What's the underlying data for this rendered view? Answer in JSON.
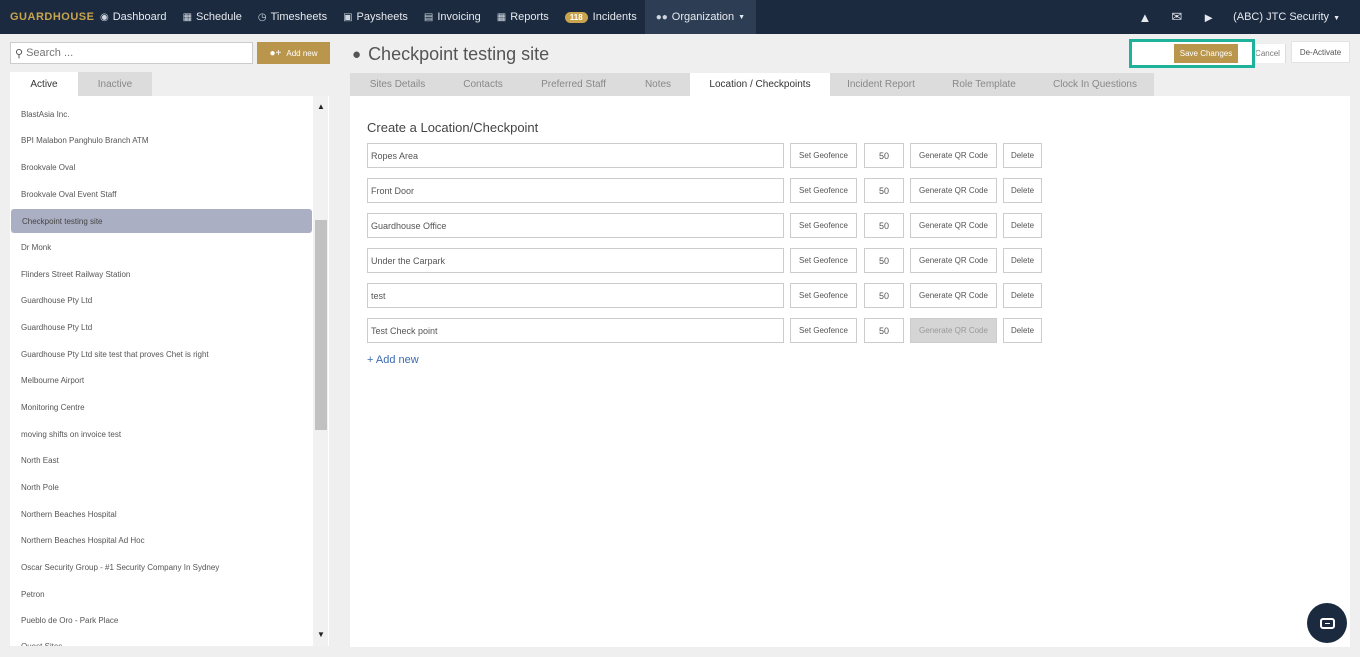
{
  "nav": {
    "brand": "GUARDHOUSE",
    "items": [
      {
        "label": "Dashboard",
        "icon": "dashboard-icon"
      },
      {
        "label": "Schedule",
        "icon": "calendar-icon"
      },
      {
        "label": "Timesheets",
        "icon": "clock-icon"
      },
      {
        "label": "Paysheets",
        "icon": "money-icon"
      },
      {
        "label": "Invoicing",
        "icon": "invoice-icon"
      },
      {
        "label": "Reports",
        "icon": "table-icon"
      },
      {
        "label": "Incidents",
        "badge": "118"
      },
      {
        "label": "Organization",
        "icon": "users-icon"
      }
    ],
    "account": "(ABC) JTC Security"
  },
  "sidebar": {
    "search_placeholder": "Search ...",
    "add_new": "Add new",
    "tabs": {
      "active": "Active",
      "inactive": "Inactive"
    },
    "sites": [
      "BlastAsia Inc.",
      "BPI Malabon Panghulo Branch ATM",
      "Brookvale Oval",
      "Brookvale Oval Event Staff",
      "Checkpoint testing site",
      "Dr Monk",
      "Flinders Street Railway Station",
      "Guardhouse Pty Ltd",
      "Guardhouse Pty Ltd",
      "Guardhouse Pty Ltd site test that proves Chet is right",
      "Melbourne Airport",
      "Monitoring Centre",
      "moving shifts on invoice test",
      "North East",
      "North Pole",
      "Northern Beaches Hospital",
      "Northern Beaches Hospital Ad Hoc",
      "Oscar Security Group - #1 Security Company In Sydney",
      "Petron",
      "Pueblo de Oro - Park Place",
      "Quest Sites"
    ],
    "selected": "Checkpoint testing site"
  },
  "header": {
    "title": "Checkpoint testing site",
    "save": "Save Changes",
    "cancel": "Cancel",
    "deactivate": "De-Activate"
  },
  "tabs": [
    "Sites Details",
    "Contacts",
    "Preferred Staff",
    "Notes",
    "Location / Checkpoints",
    "Incident Report",
    "Role Template",
    "Clock In Questions"
  ],
  "active_tab": "Location / Checkpoints",
  "checkpoints": {
    "section_title": "Create a Location/Checkpoint",
    "set_geofence": "Set Geofence",
    "generate_qr": "Generate QR Code",
    "delete": "Delete",
    "add_new": "+ Add new",
    "rows": [
      {
        "name": "Ropes Area",
        "radius": "50"
      },
      {
        "name": "Front Door",
        "radius": "50"
      },
      {
        "name": "Guardhouse Office",
        "radius": "50"
      },
      {
        "name": "Under the Carpark",
        "radius": "50"
      },
      {
        "name": "test",
        "radius": "50"
      },
      {
        "name": "Test Check point",
        "radius": "50"
      }
    ]
  },
  "colors": {
    "navbar": "#1b2a3f",
    "accent_gold": "#b9964b",
    "highlight_teal": "#1eb29a",
    "selected_item": "#abafc3"
  }
}
